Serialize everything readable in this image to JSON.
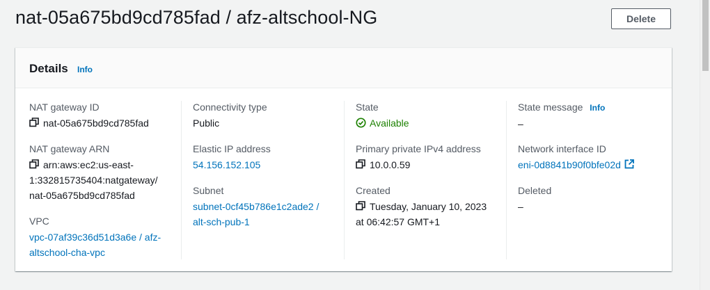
{
  "header": {
    "title": "nat-05a675bd9cd785fad / afz-altschool-NG",
    "delete_label": "Delete"
  },
  "details": {
    "title": "Details",
    "info_label": "Info",
    "nat_gateway_id": {
      "label": "NAT gateway ID",
      "value": "nat-05a675bd9cd785fad"
    },
    "nat_gateway_arn": {
      "label": "NAT gateway ARN",
      "value_line1": "arn:aws:ec2:us-east-",
      "value_line2": "1:332815735404:natgateway/",
      "value_line3": "nat-05a675bd9cd785fad"
    },
    "vpc": {
      "label": "VPC",
      "value_line1": "vpc-07af39c36d51d3a6e / afz-",
      "value_line2": "altschool-cha-vpc"
    },
    "connectivity_type": {
      "label": "Connectivity type",
      "value": "Public"
    },
    "elastic_ip": {
      "label": "Elastic IP address",
      "value": "54.156.152.105"
    },
    "subnet": {
      "label": "Subnet",
      "value_line1": "subnet-0cf45b786e1c2ade2 /",
      "value_line2": "alt-sch-pub-1"
    },
    "state": {
      "label": "State",
      "value": "Available"
    },
    "primary_private_ipv4": {
      "label": "Primary private IPv4 address",
      "value": "10.0.0.59"
    },
    "created": {
      "label": "Created",
      "value_line1": "Tuesday, January 10, 2023",
      "value_line2": "at 06:42:57 GMT+1"
    },
    "state_message": {
      "label": "State message",
      "info_label": "Info",
      "value": "–"
    },
    "network_interface_id": {
      "label": "Network interface ID",
      "value": "eni-0d8841b90f0bfe02d"
    },
    "deleted": {
      "label": "Deleted",
      "value": "–"
    }
  },
  "colors": {
    "link": "#0073bb",
    "success": "#1d8102",
    "label": "#545b64",
    "background": "#f2f3f3"
  },
  "icons": [
    "copy-icon",
    "status-available-icon",
    "external-link-icon"
  ]
}
